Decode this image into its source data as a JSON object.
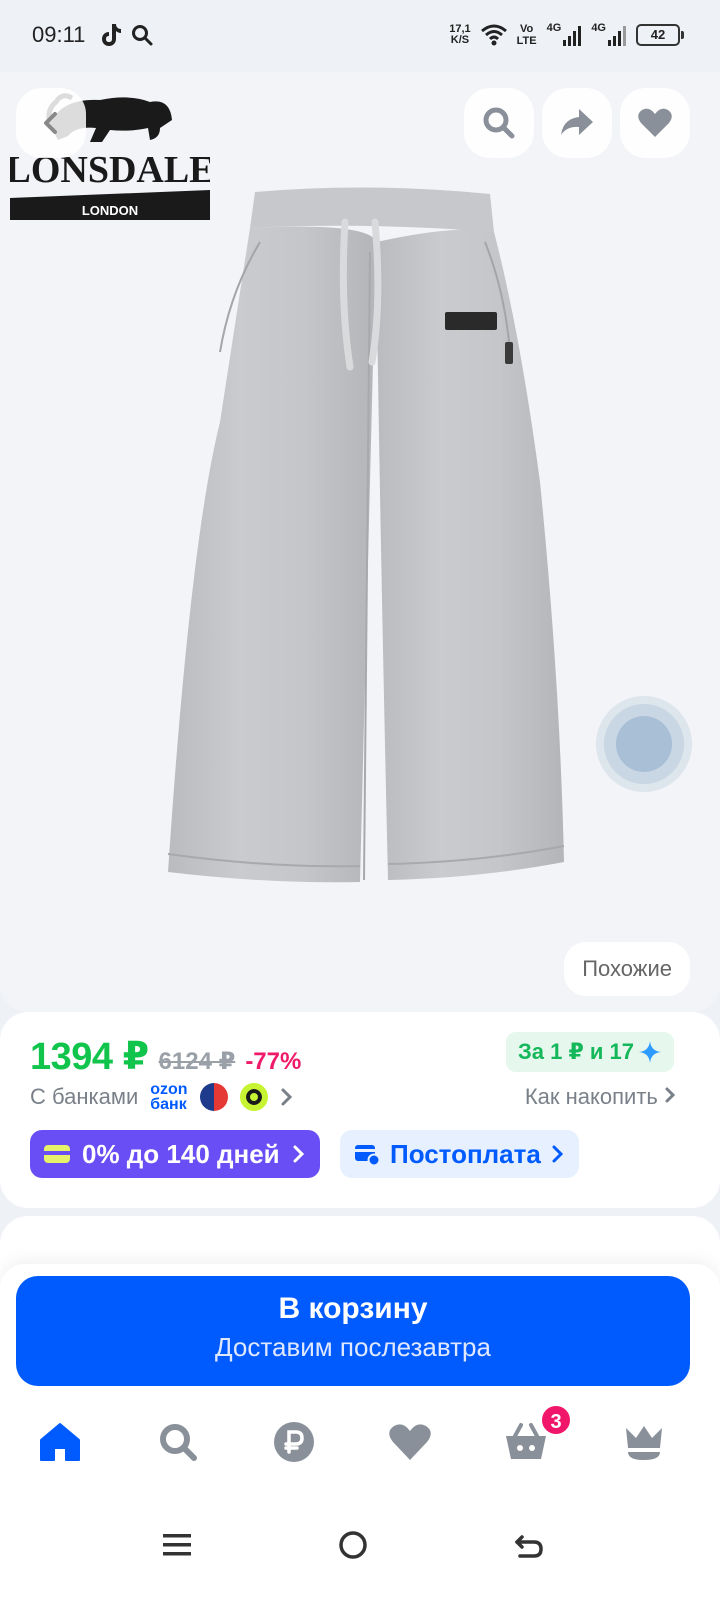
{
  "status_bar": {
    "time": "09:11",
    "net_speed_value": "17,1",
    "net_speed_unit": "K/S",
    "volte_top": "Vo",
    "volte_bottom": "LTE",
    "sim1": "4G",
    "sim2": "4G",
    "battery": "42"
  },
  "product": {
    "brand_logo_text": "LONSDALE",
    "brand_logo_sub": "LONDON",
    "similar_label": "Похожие"
  },
  "price": {
    "current": "1394 ₽",
    "old": "6124 ₽",
    "discount": "-77%",
    "points_label": "За 1 ₽ и 17",
    "banks_label": "С банками",
    "ozon_bank_line1": "ozon",
    "ozon_bank_line2": "банк",
    "how_to_save": "Как накопить",
    "installment": "0% до 140 дней",
    "postpay": "Постоплата"
  },
  "cart": {
    "title": "В корзину",
    "subtitle": "Доставим послезавтра",
    "badge_count": "3"
  },
  "icons": {
    "back": "chevron-left-icon",
    "search": "search-icon",
    "share": "share-arrow-icon",
    "favorite": "heart-icon"
  },
  "colors": {
    "brand_blue": "#005bff",
    "price_green": "#10c44c",
    "discount_pink": "#f01a6a",
    "installment_purple": "#6a4ef5"
  }
}
